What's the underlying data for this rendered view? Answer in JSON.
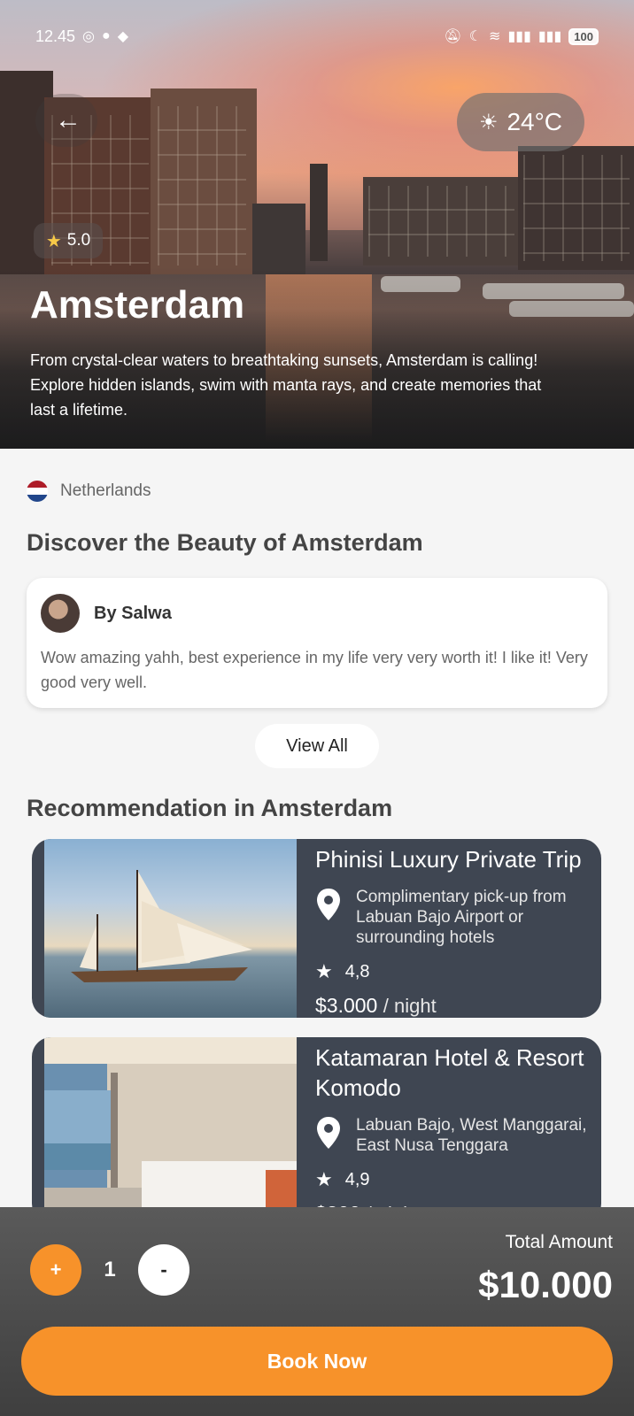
{
  "status_bar": {
    "time": "12.45",
    "battery": "100",
    "icons": [
      "whatsapp-icon",
      "chat-icon",
      "app-icon",
      "mute-icon",
      "moon-icon",
      "wifi-icon",
      "volte-icon",
      "signal-icon",
      "signal-icon",
      "battery-icon"
    ]
  },
  "hero": {
    "weather": "24°C",
    "rating": "5.0",
    "city": "Amsterdam",
    "description": "From crystal-clear waters to breathtaking sunsets, Amsterdam is calling! Explore hidden islands, swim with manta rays, and create memories that last a lifetime."
  },
  "country": {
    "name": "Netherlands",
    "flag_colors": [
      "#ae1c28",
      "#ffffff",
      "#21468b"
    ]
  },
  "discover": {
    "title": "Discover the Beauty of Amsterdam"
  },
  "review": {
    "author": "By Salwa",
    "text": "Wow amazing yahh, best experience in my life very very worth it! I like it! Very good very well."
  },
  "view_all_label": "View All",
  "recommendation": {
    "title": "Recommendation in Amsterdam",
    "items": [
      {
        "name": "Phinisi Luxury Private Trip",
        "location": "Complimentary pick-up from Labuan Bajo Airport or surrounding hotels",
        "rating": "4,8",
        "price": "$3.000",
        "unit": "/ night"
      },
      {
        "name": "Katamaran Hotel & Resort Komodo",
        "location": "Labuan Bajo, West Manggarai, East Nusa Tenggara",
        "rating": "4,9",
        "price": "$300",
        "unit": "/ night"
      }
    ]
  },
  "booking": {
    "plus": "+",
    "minus": "-",
    "quantity": "1",
    "total_label": "Total Amount",
    "total_value": "$10.000",
    "book_label": "Book Now"
  },
  "colors": {
    "accent": "#f7922a",
    "card_dark": "#3f4652",
    "bottom_bar": "#4a4a4a"
  }
}
